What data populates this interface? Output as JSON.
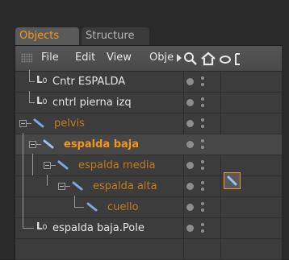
{
  "tabs": [
    {
      "label": "Objects",
      "active": true
    },
    {
      "label": "Structure",
      "active": false
    }
  ],
  "menu": {
    "items": [
      "File",
      "Edit",
      "View",
      "Obje"
    ]
  },
  "toolbar_icons": [
    "search-icon",
    "home-icon",
    "shape-icon",
    "bracket-icon"
  ],
  "objects": [
    {
      "name": "Cntr ESPALDA",
      "type": "null"
    },
    {
      "name": "cntrl pierna izq",
      "type": "null"
    },
    {
      "name": "pelvis",
      "type": "joint"
    },
    {
      "name": "espalda baja",
      "type": "joint",
      "selected": true,
      "has_tag": true
    },
    {
      "name": "espalda media",
      "type": "joint"
    },
    {
      "name": "espalda alta",
      "type": "joint"
    },
    {
      "name": "cuello",
      "type": "joint"
    },
    {
      "name": "espalda baja.Pole",
      "type": "null"
    }
  ],
  "colors": {
    "accent": "#f29a1a",
    "text": "#e6e6e6",
    "panel": "#3c3c3c"
  }
}
